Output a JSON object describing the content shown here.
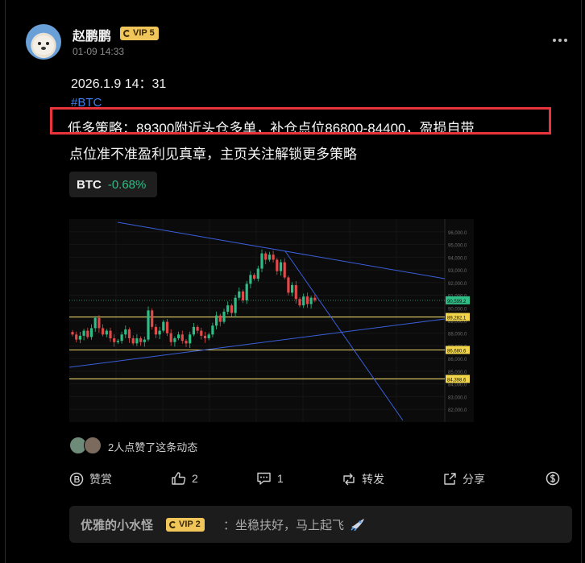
{
  "author": {
    "name": "赵鹏鹏",
    "vip": "VIP 5",
    "timestamp": "01-09 14:33"
  },
  "post": {
    "datetime": "2026.1.9 14：31",
    "hashtag": "#BTC",
    "line1": "低多策略：89300附近头仓多单，补仓点位86800-84400，盈损自带",
    "line2": "点位准不准盈利见真章，主页关注解锁更多策略"
  },
  "ticker": {
    "symbol": "BTC",
    "change": "-0.68%",
    "change_color": "#2ebd85"
  },
  "chart_data": {
    "type": "candlestick",
    "y_axis_ticks": [
      "96,000.0",
      "95,000.0",
      "94,000.0",
      "93,000.0",
      "92,000.0",
      "91,000.0",
      "90,000.0",
      "89,000.0",
      "88,000.0",
      "87,000.0",
      "86,000.0",
      "85,000.0",
      "84,000.0",
      "83,000.0",
      "82,000.0"
    ],
    "ylim": [
      81500,
      96500
    ],
    "price_labels": [
      {
        "value": 90599,
        "text": "90,599.2",
        "color": "#2ebd85"
      },
      {
        "value": 89282,
        "text": "89,282.1",
        "color": "#f0d44a"
      },
      {
        "value": 86680,
        "text": "86,680.6",
        "color": "#f0d44a"
      },
      {
        "value": 84398,
        "text": "84,398.6",
        "color": "#f0d44a"
      }
    ],
    "horizontal_levels": [
      89282,
      86680,
      84398
    ],
    "close_series": [
      87900,
      87500,
      87800,
      88200,
      87700,
      88400,
      89200,
      88400,
      87900,
      88200,
      87600,
      87300,
      87400,
      87900,
      88300,
      87600,
      87200,
      87600,
      87300,
      87500,
      89800,
      88500,
      87900,
      88200,
      88900,
      88000,
      87300,
      87600,
      87900,
      87400,
      87200,
      87900,
      88500,
      88200,
      87800,
      87600,
      87900,
      88600,
      89400,
      88900,
      89700,
      90200,
      89600,
      90800,
      91300,
      90600,
      91900,
      92600,
      92300,
      93100,
      94300,
      93800,
      94200,
      93800,
      92900,
      93600,
      92400,
      91200,
      91800,
      90700,
      90200,
      90900,
      90300,
      90800,
      90600
    ]
  },
  "likes": {
    "text": "2人点赞了这条动态"
  },
  "actions": {
    "tip": "赞赏",
    "like_count": "2",
    "comment_count": "1",
    "repost": "转发",
    "share": "分享"
  },
  "comment": {
    "name": "优雅的小水怪",
    "vip": "VIP 2",
    "text": "：坐稳扶好，马上起飞"
  }
}
